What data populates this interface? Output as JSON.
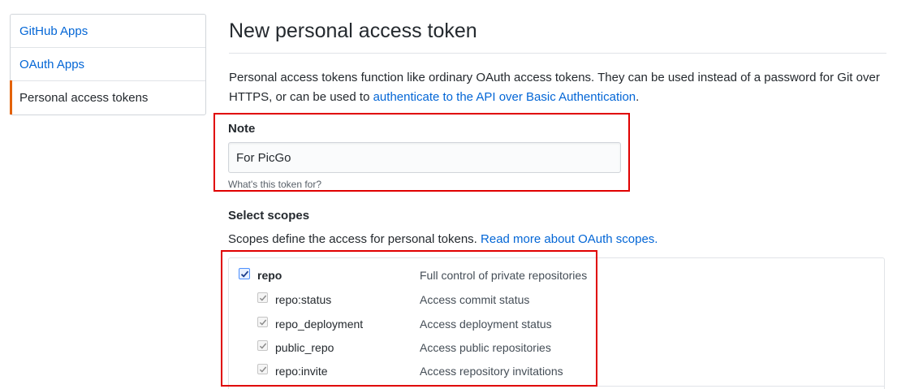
{
  "sidebar": {
    "items": [
      {
        "label": "GitHub Apps",
        "selected": false
      },
      {
        "label": "OAuth Apps",
        "selected": false
      },
      {
        "label": "Personal access tokens",
        "selected": true
      }
    ]
  },
  "page": {
    "title": "New personal access token",
    "intro_text_1": "Personal access tokens function like ordinary OAuth access tokens. They can be used instead of a password for Git over HTTPS, or can be used to ",
    "intro_link": "authenticate to the API over Basic Authentication",
    "intro_text_2": "."
  },
  "note": {
    "label": "Note",
    "value": "For PicGo",
    "hint": "What's this token for?"
  },
  "scopes": {
    "label": "Select scopes",
    "desc_text": "Scopes define the access for personal tokens. ",
    "desc_link": "Read more about OAuth scopes.",
    "items": [
      {
        "name": "repo",
        "desc": "Full control of private repositories",
        "checked": true
      },
      {
        "name": "repo:status",
        "desc": "Access commit status",
        "checked": true
      },
      {
        "name": "repo_deployment",
        "desc": "Access deployment status",
        "checked": true
      },
      {
        "name": "public_repo",
        "desc": "Access public repositories",
        "checked": true
      },
      {
        "name": "repo:invite",
        "desc": "Access repository invitations",
        "checked": true
      }
    ]
  },
  "colors": {
    "link": "#0366d6",
    "selected_nav_accent": "#e36209",
    "annotation_box": "#e00000"
  }
}
